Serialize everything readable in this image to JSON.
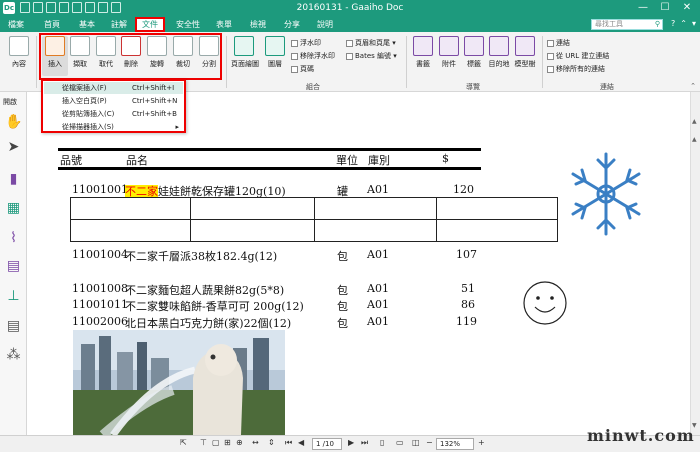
{
  "window": {
    "app_icon": "Dc",
    "title": "20160131 - Gaaiho Doc",
    "controls": [
      "—",
      "☐",
      "✕"
    ]
  },
  "menu": {
    "tabs": [
      "檔案",
      "首頁",
      "基本",
      "註解",
      "文件",
      "安全性",
      "表單",
      "檢視",
      "分享",
      "說明"
    ],
    "active_tab": "文件",
    "search_placeholder": "尋找工具"
  },
  "ribbon": {
    "page_label": "內容",
    "insert_group": [
      "插入",
      "擷取",
      "取代",
      "刪除",
      "旋轉",
      "裁切",
      "分割"
    ],
    "page_layout_label": "頁面繪圖",
    "layers_label": "圖層",
    "watermark_items": [
      "浮水印",
      "移除浮水印",
      "頁眉和頁尾",
      "Bates 編號",
      "頁碼"
    ],
    "combine_group_label": "組合",
    "nav_items": [
      "書籤",
      "附件",
      "標籤",
      "目的地",
      "模型樹"
    ],
    "nav_group_label": "導覽",
    "link_items": [
      "連結",
      "從 URL 建立連結",
      "移除所有的連結"
    ],
    "link_group_label": "連結"
  },
  "sidebar": {
    "open_label": "開啟"
  },
  "insert_menu": {
    "items": [
      {
        "label": "從檔案插入(F)",
        "shortcut": "Ctrl+Shift+I",
        "highlighted": true
      },
      {
        "label": "插入空白頁(P)",
        "shortcut": "Ctrl+Shift+N",
        "highlighted": false
      },
      {
        "label": "從剪貼簿插入(C)",
        "shortcut": "Ctrl+Shift+B",
        "highlighted": false
      },
      {
        "label": "從掃描器插入(S)",
        "shortcut": "",
        "highlighted": false,
        "submenu": true
      }
    ]
  },
  "document": {
    "headers": {
      "code": "品號",
      "name": "品名",
      "unit": "單位",
      "warehouse": "庫別",
      "price": "$"
    },
    "rows": [
      {
        "code": "11001001",
        "name_highlight": "不二家",
        "name_rest": "娃娃餅乾保存罐120g(10)",
        "unit": "罐",
        "warehouse": "A01",
        "price": "120"
      },
      {
        "code": "11001004",
        "name": "不二家千層派38枚182.4g(12)",
        "unit": "包",
        "warehouse": "A01",
        "price": "107"
      },
      {
        "code": "11001008",
        "name": "不二家麵包超人蔬果餅82g(5*8)",
        "unit": "包",
        "warehouse": "A01",
        "price": "51"
      },
      {
        "code": "11001011",
        "name": "不二家雙味餡餅-香草可可 200g(12)",
        "unit": "包",
        "warehouse": "A01",
        "price": "86"
      },
      {
        "code": "11002006",
        "name": "北日本黑白巧克力餅(家)22個(12)",
        "unit": "包",
        "warehouse": "A01",
        "price": "119"
      }
    ]
  },
  "statusbar": {
    "page": "1 /10",
    "zoom": "132%"
  },
  "watermark": "minwt.com",
  "colors": {
    "accent": "#1d9a7d",
    "highlight_red": "#e00000",
    "highlight_yellow": "#ffee00",
    "snowflake": "#3a7fc4"
  }
}
